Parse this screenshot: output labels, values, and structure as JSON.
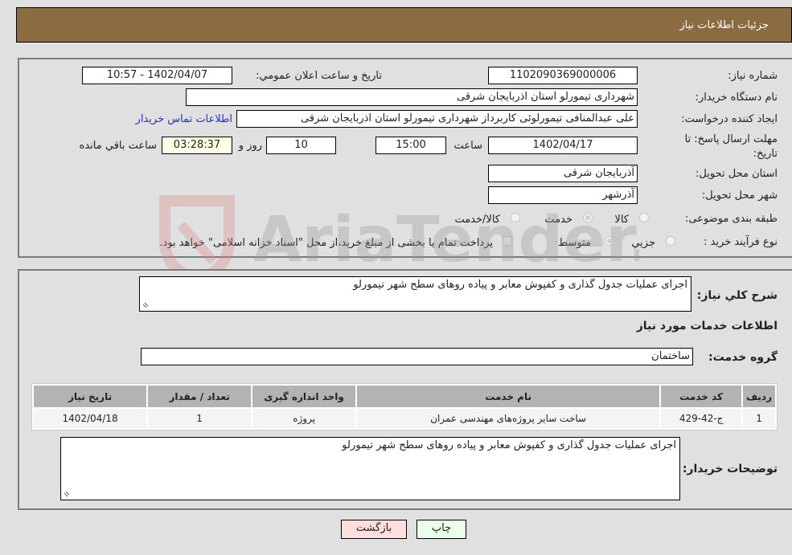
{
  "header": {
    "title": "جزئیات اطلاعات نیاز"
  },
  "form": {
    "need_number": {
      "label": "شماره نیاز:",
      "value": "1102090369000006"
    },
    "announce_datetime": {
      "label": "تاریخ و ساعت اعلان عمومي:",
      "value": "1402/04/07 - 10:57"
    },
    "buyer_org": {
      "label": "نام دستگاه خریدار:",
      "value": "شهرداری تیمورلو استان اذربایجان شرقی"
    },
    "requester": {
      "label": "ایجاد کننده درخواست:",
      "value": "علی عبدالمنافی تیمورلوئی کاربرداز شهرداری تیمورلو استان اذربایجان شرقی"
    },
    "buyer_contact_link": "اطلاعات تماس خریدار",
    "deadline": {
      "label_line1": "مهلت ارسال پاسخ: تا",
      "label_line2": "تاریخ:",
      "date": "1402/04/17",
      "time_label": "ساعت",
      "time": "15:00",
      "days": "10",
      "days_label": "روز و",
      "remaining": "03:28:37",
      "remaining_label": "ساعت باقي مانده"
    },
    "delivery_province": {
      "label": "استان محل تحویل:",
      "value": "آذربایجان شرقی"
    },
    "delivery_city": {
      "label": "شهر محل تحویل:",
      "value": "آذرشهر"
    },
    "category": {
      "label": "طبقه بندی موضوعی:",
      "options": [
        {
          "label": "کالا",
          "checked": false
        },
        {
          "label": "خدمت",
          "checked": true
        },
        {
          "label": "کالا/خدمت",
          "checked": false
        }
      ]
    },
    "purchase_type": {
      "label": "نوع فرآیند خرید :",
      "options": [
        {
          "label": "جزيي",
          "checked": false
        },
        {
          "label": "متوسط",
          "checked": true
        }
      ],
      "treasury_checkbox_label": "پرداخت تمام یا بخشی از مبلغ خرید،از محل \"اسناد خزانه اسلامی\" خواهد بود.",
      "treasury_checked": false
    }
  },
  "details": {
    "general_desc_label": "شرح کلي نیاز:",
    "general_desc": "اجرای عملیات جدول گذاری و کفپوش معابر و پیاده روهای سطح شهر تیمورلو",
    "services_title": "اطلاعات خدمات مورد نیاز",
    "service_group_label": "گروه خدمت:",
    "service_group": "ساختمان",
    "table": {
      "headers": [
        "ردیف",
        "کد خدمت",
        "نام خدمت",
        "واحد اندازه گیری",
        "تعداد / مقدار",
        "تاریخ نیاز"
      ],
      "rows": [
        [
          "1",
          "ج-42-429",
          "ساخت سایر پروژه‌های مهندسی عمران",
          "پروژه",
          "1",
          "1402/04/18"
        ]
      ]
    },
    "buyer_notes_label": "توضیحات خریدار:",
    "buyer_notes": "اجرای عملیات جدول گذاری و کفپوش معابر و پیاده روهای سطح شهر تیمورلو"
  },
  "buttons": {
    "print": "چاپ",
    "back": "بازگشت"
  },
  "watermark": {
    "text": "AriaTender.neT"
  },
  "colors": {
    "header_bg": "#8b6c42",
    "link": "#2b2bd6",
    "print_bg": "#eaffea",
    "back_bg": "#ffdede"
  }
}
